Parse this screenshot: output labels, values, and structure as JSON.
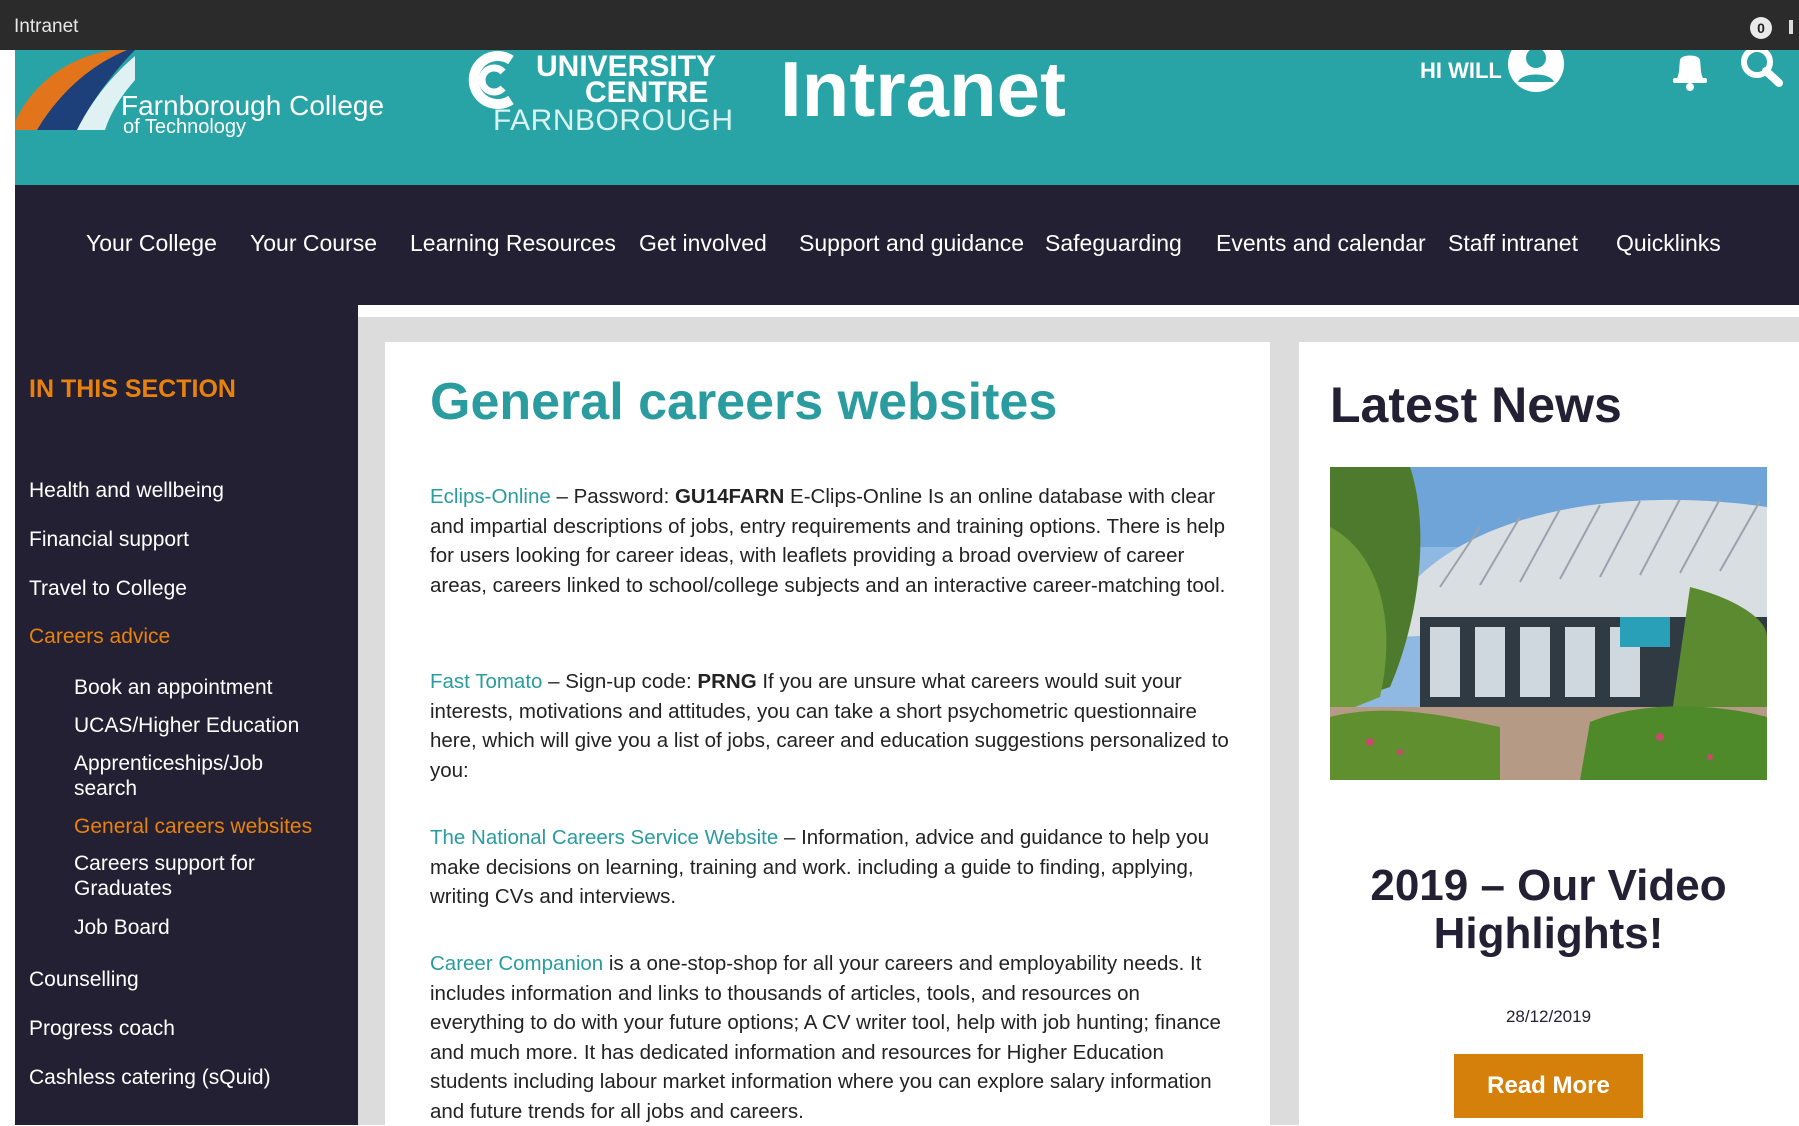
{
  "window": {
    "title": "Intranet",
    "notification_count": "0"
  },
  "header": {
    "college_name": "Farnborough College",
    "college_sub": "of Technology",
    "uc_line1": "UNIVERSITY",
    "uc_line2": "CENTRE",
    "uc_line3": "FARNBOROUGH",
    "site_title": "Intranet",
    "greeting": "HI WILL",
    "brand_color": "#28a3a6"
  },
  "nav": {
    "items": [
      {
        "label": "Your College"
      },
      {
        "label": "Your Course"
      },
      {
        "label": "Learning Resources"
      },
      {
        "label": "Get involved"
      },
      {
        "label": "Support and guidance"
      },
      {
        "label": "Safeguarding"
      },
      {
        "label": "Events and calendar"
      },
      {
        "label": "Staff intranet"
      },
      {
        "label": "Quicklinks"
      }
    ]
  },
  "sidebar": {
    "heading": "IN THIS SECTION",
    "items": [
      {
        "label": "Health and wellbeing"
      },
      {
        "label": "Financial support"
      },
      {
        "label": "Travel to College"
      },
      {
        "label": "Careers advice"
      },
      {
        "label": "Counselling"
      },
      {
        "label": "Progress coach"
      },
      {
        "label": "Cashless catering (sQuid)"
      }
    ],
    "subitems": [
      {
        "label": "Book an appointment"
      },
      {
        "label": "UCAS/Higher Education"
      },
      {
        "label": "Apprenticeships/Job search"
      },
      {
        "label": "General careers websites"
      },
      {
        "label": "Careers support for Graduates"
      },
      {
        "label": "Job Board"
      }
    ],
    "accent_color": "#e8820c"
  },
  "main": {
    "title": "General careers websites",
    "entries": [
      {
        "link": "Eclips-Online",
        "pre": " – Password: ",
        "code": "GU14FARN",
        "text": "  E-Clips-Online Is an online database with clear and impartial descriptions of jobs, entry requirements and training options. There is help for users looking for career ideas, with leaflets providing a broad overview of career areas, careers linked to school/college subjects and an interactive career-matching tool."
      },
      {
        "link": "Fast Tomato",
        "pre": " –  Sign-up code: ",
        "code": "PRNG",
        "text": "  If you are unsure what careers would suit your interests, motivations and attitudes, you can take a short psychometric questionnaire here, which will give you a list of jobs, career and education suggestions personalized to you:"
      },
      {
        "link": "The National Careers Service Website",
        "text": " – Information, advice and guidance to help you make decisions on learning, training and work. including a guide to finding, applying, writing CVs and interviews."
      },
      {
        "link": "Career Companion",
        "text": " is a one-stop-shop for all your careers and employability needs. It includes information and links to thousands of articles, tools, and resources on everything to do with your future options; A CV writer tool, help with job hunting; finance and much more.  It has dedicated information and resources for Higher Education students including labour market information where you can explore salary information and future trends for all jobs and careers."
      }
    ]
  },
  "news": {
    "heading": "Latest News",
    "article_title": "2019 – Our Video Highlights!",
    "date": "28/12/2019",
    "button_label": "Read More",
    "button_color": "#d5800a"
  }
}
